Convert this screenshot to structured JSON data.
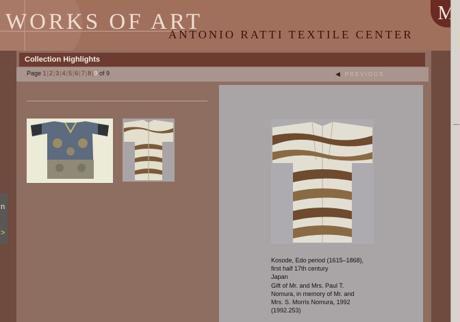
{
  "header": {
    "site_title": "WORKS OF ART",
    "center_title": "ANTONIO RATTI TEXTILE CENTER",
    "monogram": "M"
  },
  "side_tab": {
    "glyph_top": "n",
    "glyph_bottom": ">"
  },
  "section": {
    "title": "Collection Highlights"
  },
  "pager": {
    "label": "Page",
    "pages": [
      "1",
      "2",
      "3",
      "4",
      "5",
      "6",
      "7",
      "8",
      "9"
    ],
    "current": "9",
    "of_text": "of 9",
    "previous_label": "PREVIOUS"
  },
  "thumbnails": [
    {
      "icon": "dragon-robe-thumbnail"
    },
    {
      "icon": "kosode-thumbnail"
    }
  ],
  "featured": {
    "caption": [
      "Kosode, Edo period (1615–1868),",
      "first half 17th century",
      "Japan",
      "Gift of Mr. and Mrs. Paul T.",
      "Nomura, in memory of Mr. and",
      "Mrs. S. Morris Nomura, 1992",
      "(1992.253)"
    ]
  },
  "colors": {
    "header_bg": "#a0705d",
    "section_bar": "#6e3b30",
    "panel_bg": "#a9a4a6",
    "content_bg": "#8f6e62"
  }
}
